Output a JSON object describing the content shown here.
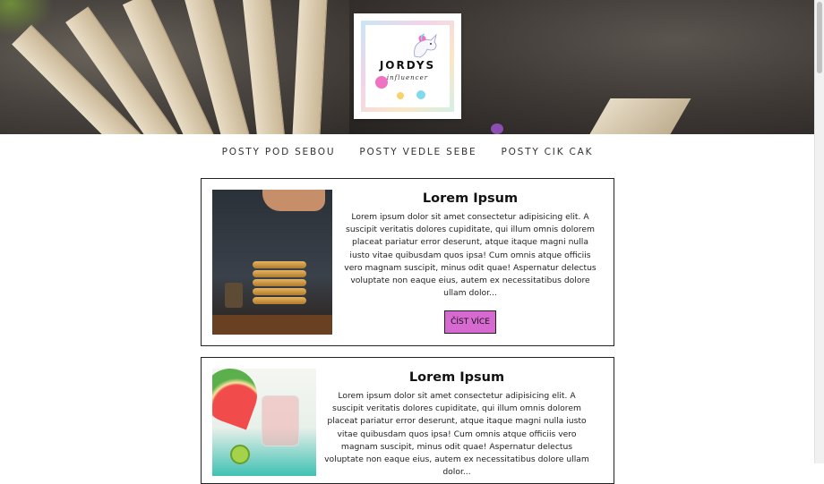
{
  "logo": {
    "title": "JORDYS",
    "subtitle": "influencer"
  },
  "nav": {
    "items": [
      {
        "label": "POSTY POD SEBOU"
      },
      {
        "label": "POSTY VEDLE SEBE"
      },
      {
        "label": "POSTY CIK CAK"
      }
    ]
  },
  "posts": [
    {
      "title": "Lorem Ipsum",
      "text": "Lorem ipsum dolor sit amet consectetur adipisicing elit. A suscipit veritatis dolores cupiditate, qui illum omnis dolorem placeat pariatur error deserunt, atque itaque magni nulla iusto vitae quibusdam quos ipsa! Cum omnis atque officiis vero magnam suscipit, minus odit quae! Aspernatur delectus voluptate non eaque eius, autem ex necessitatibus dolore ullam dolor...",
      "button": "ČÍST VÍCE",
      "image": "pancakes-photo"
    },
    {
      "title": "Lorem Ipsum",
      "text": "Lorem ipsum dolor sit amet consectetur adipisicing elit. A suscipit veritatis dolores cupiditate, qui illum omnis dolorem placeat pariatur error deserunt, atque itaque magni nulla iusto vitae quibusdam quos ipsa! Cum omnis atque officiis vero magnam suscipit, minus odit quae! Aspernatur delectus voluptate non eaque eius, autem ex necessitatibus dolore ullam dolor...",
      "image": "watermelon-drink-photo"
    }
  ],
  "colors": {
    "button": "#d76ad0",
    "border": "#222222"
  }
}
